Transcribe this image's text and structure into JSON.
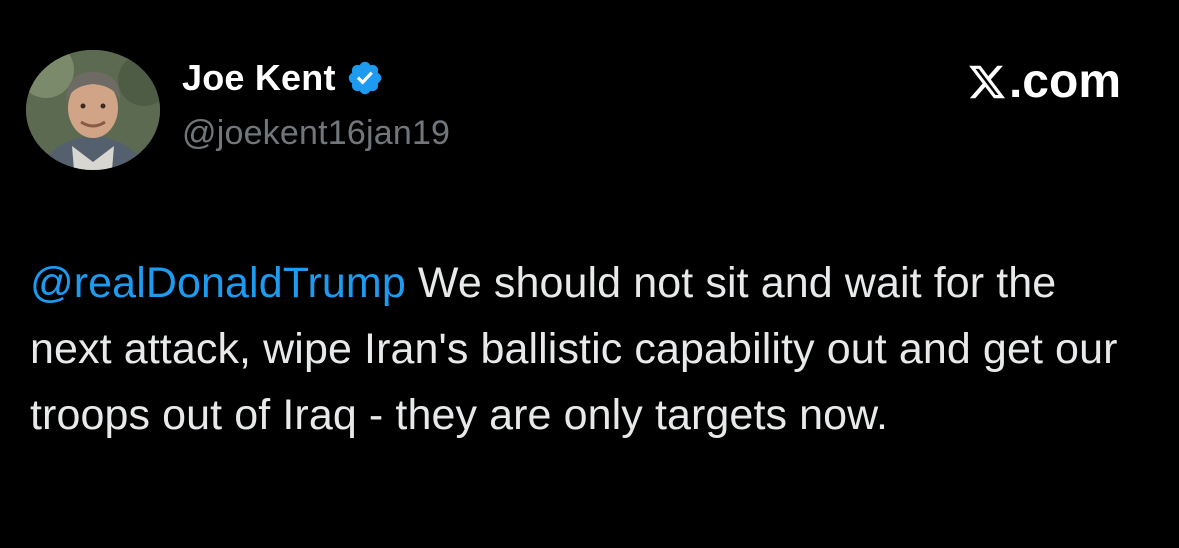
{
  "author": {
    "display_name": "Joe Kent",
    "handle": "@joekent16jan19",
    "verified": true,
    "verified_icon": "verified-badge-icon",
    "avatar": "profile-photo"
  },
  "brand": {
    "icon": "x-logo-icon",
    "text": ".com"
  },
  "tweet": {
    "mention": "@realDonaldTrump",
    "body": " We should not sit and wait for the next attack, wipe Iran's ballistic capability out and get our troops out of Iraq - they are only targets now."
  },
  "colors": {
    "background": "#000000",
    "text": "#e7e9ea",
    "secondary": "#71767b",
    "link": "#1d9bf0",
    "verified": "#1d9bf0"
  }
}
